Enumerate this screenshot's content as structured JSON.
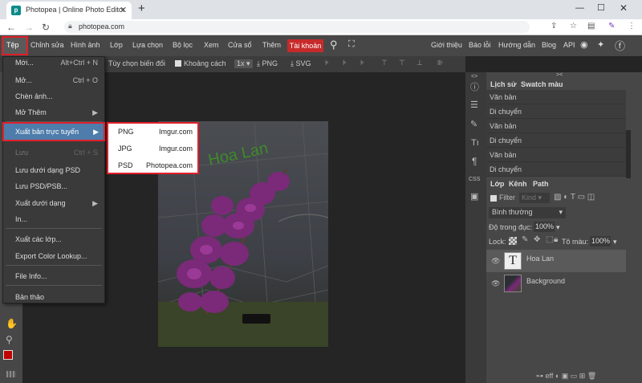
{
  "browser": {
    "tab_title": "Photopea | Online Photo Editor",
    "url": "photopea.com",
    "favicon_letter": "p"
  },
  "menubar": {
    "items": [
      "Tệp",
      "Chỉnh sửa",
      "Hình ảnh",
      "Lớp",
      "Lựa chọn",
      "Bộ lọc",
      "Xem",
      "Cửa sổ",
      "Thêm"
    ],
    "account": "Tài khoản",
    "right_links": [
      "Giới thiệu",
      "Báo lỗi",
      "Hướng dẫn",
      "Blog",
      "API"
    ]
  },
  "optionsbar": {
    "transform_label": "Tùy chọn biến đổi",
    "distance_label": "Khoảng cách",
    "zoom": "1x",
    "png_label": "PNG",
    "svg_label": "SVG"
  },
  "filemenu": {
    "items": [
      {
        "label": "Mới...",
        "shortcut": "Alt+Ctrl + N"
      },
      {
        "label": "Mở...",
        "shortcut": "Ctrl + O"
      },
      {
        "label": "Chèn ảnh..."
      },
      {
        "label": "Mở Thêm"
      },
      {
        "label": "Xuất bản trực tuyến"
      },
      {
        "label": "Lưu",
        "shortcut": "Ctrl + S"
      },
      {
        "label": "Lưu dưới dạng PSD"
      },
      {
        "label": "Lưu PSD/PSB..."
      },
      {
        "label": "Xuất dưới dạng"
      },
      {
        "label": "In..."
      },
      {
        "label": "Xuất các lớp..."
      },
      {
        "label": "Export Color Lookup..."
      },
      {
        "label": "File Info..."
      },
      {
        "label": "Bản thảo"
      }
    ]
  },
  "submenu": {
    "items": [
      {
        "format": "PNG",
        "host": "Imgur.com"
      },
      {
        "format": "JPG",
        "host": "Imgur.com"
      },
      {
        "format": "PSD",
        "host": "Photopea.com"
      }
    ]
  },
  "canvas": {
    "watermark_text": "Hoa Lan"
  },
  "history_panel": {
    "tabs": [
      "Lịch sử",
      "Swatch màu"
    ],
    "items": [
      "Văn bản",
      "Di chuyển",
      "Văn bản",
      "Di chuyển",
      "Văn bản",
      "Di chuyển"
    ]
  },
  "layers_panel": {
    "tabs": [
      "Lớp",
      "Kênh",
      "Path"
    ],
    "filter_label": "Filter",
    "kind_label": "Kind",
    "blend_mode": "Bình thường",
    "opacity_label": "Độ trong đục:",
    "opacity_value": "100%",
    "lock_label": "Lock:",
    "fill_label": "Tô màu:",
    "fill_value": "100%",
    "layers": [
      {
        "name": "Hoa Lan",
        "type": "text"
      },
      {
        "name": "Background",
        "type": "image"
      }
    ]
  },
  "colors": {
    "accent_red": "#e0202a",
    "highlight_blue": "#4e7cab",
    "foreground_swatch": "#c00000"
  }
}
